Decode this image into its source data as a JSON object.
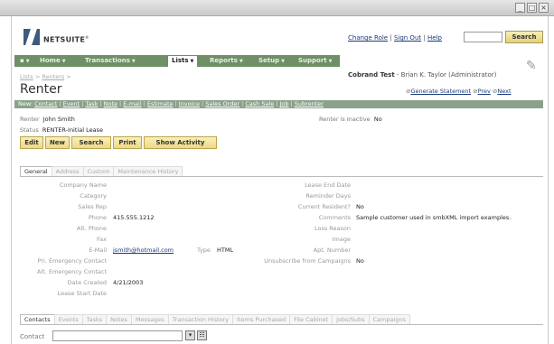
{
  "window": {
    "minimize": "_",
    "maximize": "□",
    "close": "×"
  },
  "brand": {
    "name": "NETSUITE",
    "reg": "®"
  },
  "toplinks": {
    "change_role": "Change Role",
    "sign_out": "Sign Out",
    "help": "Help",
    "sep": "|",
    "search_label": "Search"
  },
  "nav": [
    {
      "label": "Home"
    },
    {
      "label": "Transactions"
    },
    {
      "label": "Lists",
      "active": true
    },
    {
      "label": "Reports"
    },
    {
      "label": "Setup"
    },
    {
      "label": "Support"
    }
  ],
  "breadcrumb": {
    "a": "Lists",
    "b": "Renters",
    "sep": ">"
  },
  "company": {
    "name": "Cobrand Test",
    "user": "- Brian K. Taylor (Administrator)"
  },
  "title": "Renter",
  "record_links": {
    "generate": "Generate Statement",
    "prev": "Prev",
    "next": "Next"
  },
  "newbar": {
    "label": "New:",
    "items": [
      "Contact",
      "Event",
      "Task",
      "Note",
      "E-mail",
      "Estimate",
      "Invoice",
      "Sales Order",
      "Cash Sale",
      "Job",
      "Subrenter"
    ]
  },
  "summary": {
    "renter_label": "Renter",
    "renter_value": "John Smith",
    "status_label": "Status",
    "status_value": "RENTER-Initial Lease",
    "inactive_label": "Renter is Inactive",
    "inactive_value": "No"
  },
  "buttons": {
    "edit": "Edit",
    "new": "New",
    "search": "Search",
    "print": "Print",
    "show_activity": "Show Activity"
  },
  "tabs": [
    "General",
    "Address",
    "Custom",
    "Maintenance History"
  ],
  "left_fields": [
    {
      "label": "Company Name",
      "value": ""
    },
    {
      "label": "Category",
      "value": ""
    },
    {
      "label": "Sales Rep",
      "value": ""
    },
    {
      "label": "Phone",
      "value": "415.555.1212"
    },
    {
      "label": "Alt. Phone",
      "value": ""
    },
    {
      "label": "Fax",
      "value": ""
    },
    {
      "label": "E-Mail",
      "value": "jsmith@hotmail.com",
      "extra_label": "Type",
      "extra_value": "HTML"
    },
    {
      "label": "Pri. Emergency Contact",
      "value": ""
    },
    {
      "label": "Alt. Emergency Contact",
      "value": ""
    },
    {
      "label": "Date Created",
      "value": "4/21/2003"
    },
    {
      "label": "Lease Start Date",
      "value": ""
    }
  ],
  "right_fields": [
    {
      "label": "Lease End Date",
      "value": ""
    },
    {
      "label": "Reminder Days",
      "value": ""
    },
    {
      "label": "Current Resident?",
      "value": "No"
    },
    {
      "label": "Comments",
      "value": "Sample customer used in smbXML import examples."
    },
    {
      "label": "Loss Reason",
      "value": ""
    },
    {
      "label": "Image",
      "value": ""
    },
    {
      "label": "Apt. Number",
      "value": ""
    },
    {
      "label": "Unsubscribe from Campaigns",
      "value": "No"
    }
  ],
  "bottom_tabs": [
    "Contacts",
    "Events",
    "Tasks",
    "Notes",
    "Messages",
    "Transaction History",
    "Items Purchased",
    "File Cabinet",
    "Jobs/Subs",
    "Campaigns"
  ],
  "contact": {
    "label": "Contact",
    "select_icon": "▾",
    "list_icon": "☷"
  }
}
